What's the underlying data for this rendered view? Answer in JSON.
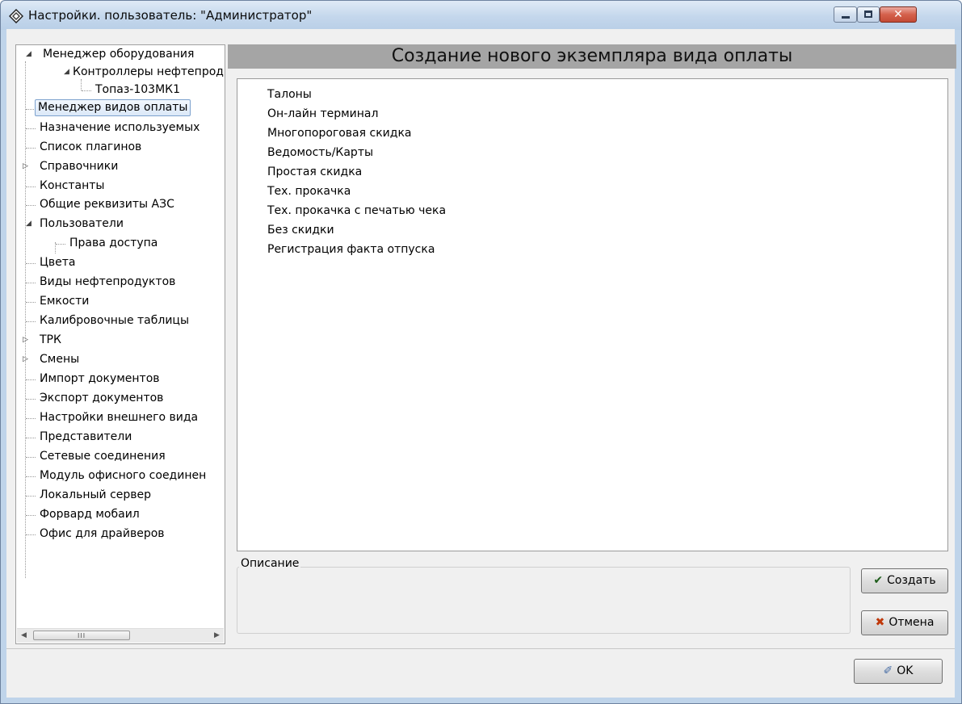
{
  "window": {
    "title": "Настройки. пользователь: \"Администратор\"",
    "close_glyph": "✕"
  },
  "tree": {
    "items": [
      {
        "label": "Менеджер оборудования",
        "expander": "◢"
      },
      {
        "label": "Контроллеры нефтепрод",
        "expander": "◢"
      },
      {
        "label": "Топаз-103МК1"
      },
      {
        "label": "Менеджер видов оплаты",
        "selected": true
      },
      {
        "label": "Назначение используемых"
      },
      {
        "label": "Список плагинов"
      },
      {
        "label": "Справочники",
        "expander": "▷"
      },
      {
        "label": "Константы"
      },
      {
        "label": "Общие реквизиты АЗС"
      },
      {
        "label": "Пользователи",
        "expander": "◢"
      },
      {
        "label": "Права доступа"
      },
      {
        "label": "Цвета"
      },
      {
        "label": "Виды нефтепродуктов"
      },
      {
        "label": "Емкости"
      },
      {
        "label": "Калибровочные таблицы"
      },
      {
        "label": "ТРК",
        "expander": "▷"
      },
      {
        "label": "Смены",
        "expander": "▷"
      },
      {
        "label": "Импорт документов"
      },
      {
        "label": "Экспорт документов"
      },
      {
        "label": "Настройки внешнего вида"
      },
      {
        "label": "Представители"
      },
      {
        "label": "Сетевые соединения"
      },
      {
        "label": "Модуль офисного соединен"
      },
      {
        "label": "Локальный сервер"
      },
      {
        "label": "Форвард мобаил"
      },
      {
        "label": "Офис для драйверов"
      }
    ],
    "scroll": {
      "left_arrow": "◀",
      "right_arrow": "▶",
      "grip": "III"
    }
  },
  "header": {
    "title": "Создание нового экземпляра вида оплаты"
  },
  "payment_types": [
    "Талоны",
    "Он-лайн терминал",
    "Многопороговая скидка",
    "Ведомость/Карты",
    "Простая скидка",
    "Тех. прокачка",
    "Тех. прокачка с печатью чека",
    "Без скидки",
    "Регистрация факта отпуска"
  ],
  "description": {
    "label": "Описание"
  },
  "buttons": {
    "create": {
      "label": "Создать",
      "icon": "✔"
    },
    "cancel": {
      "label": "Отмена",
      "icon": "✖"
    },
    "ok": {
      "label": "OK",
      "icon": "✐"
    }
  },
  "colors": {
    "header_bg": "#a5a5a5",
    "selection_border": "#7da2ce",
    "close_button": "#c44a35"
  }
}
